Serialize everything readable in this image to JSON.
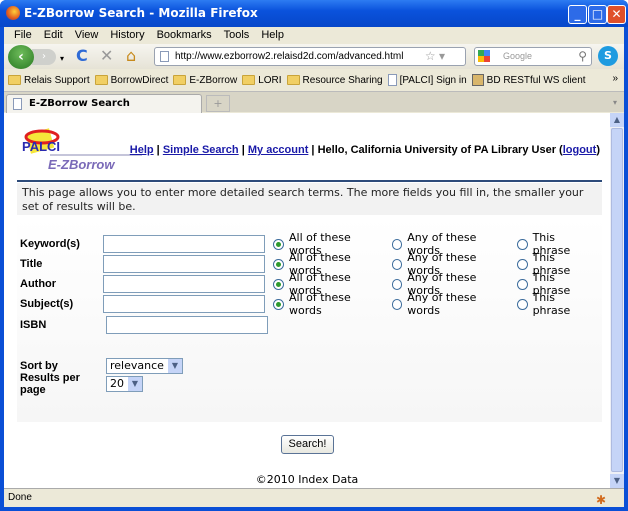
{
  "window": {
    "title": "E-ZBorrow Search - Mozilla Firefox"
  },
  "menu": [
    "File",
    "Edit",
    "View",
    "History",
    "Bookmarks",
    "Tools",
    "Help"
  ],
  "nav": {
    "url": "http://www.ezborrow2.relaisd2d.com/advanced.html",
    "search_placeholder": "Google"
  },
  "bookmarks": [
    {
      "label": "Relais Support",
      "icon": "folder"
    },
    {
      "label": "BorrowDirect",
      "icon": "folder"
    },
    {
      "label": "E-ZBorrow",
      "icon": "folder"
    },
    {
      "label": "LORI",
      "icon": "folder"
    },
    {
      "label": "Resource Sharing",
      "icon": "folder"
    },
    {
      "label": "[PALCI] Sign in",
      "icon": "page"
    },
    {
      "label": "BD RESTful WS client",
      "icon": "image"
    }
  ],
  "tab": {
    "label": "E-ZBorrow Search"
  },
  "page": {
    "logo_text": "PALCI E-ZBorrow",
    "links": {
      "help": "Help",
      "simple": "Simple Search",
      "account": "My account",
      "greeting": "Hello, California University of PA Library User",
      "logout": "logout"
    },
    "description": "This page allows you to enter more detailed search terms. The more fields you fill in, the smaller your set of results will be.",
    "fields": [
      {
        "label": "Keyword(s)",
        "value": "",
        "has_mode": true
      },
      {
        "label": "Title",
        "value": "",
        "has_mode": true
      },
      {
        "label": "Author",
        "value": "",
        "has_mode": true
      },
      {
        "label": "Subject(s)",
        "value": "",
        "has_mode": true
      },
      {
        "label": "ISBN",
        "value": "",
        "has_mode": false
      }
    ],
    "modes": [
      "All of these words",
      "Any of these words",
      "This phrase"
    ],
    "selected_mode": "All of these words",
    "sort": {
      "label": "Sort by",
      "value": "relevance"
    },
    "per_page": {
      "label": "Results per page",
      "value": "20"
    },
    "search_button": "Search!",
    "footer": "©2010 Index Data"
  },
  "status": "Done",
  "colors": {
    "titlebar": "#0a52dc",
    "link": "#1a1aa8",
    "rule": "#2d4b7a"
  }
}
